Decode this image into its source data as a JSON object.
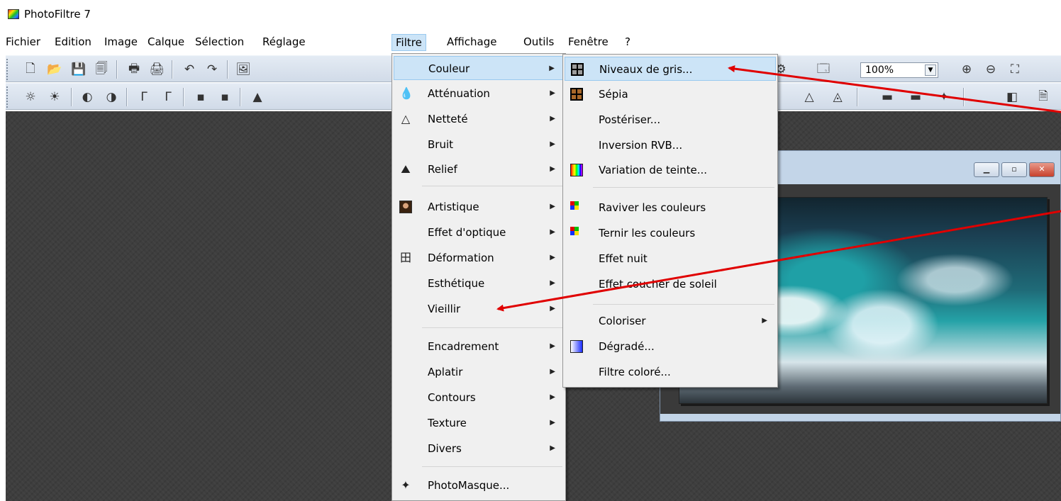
{
  "app": {
    "title": "PhotoFiltre 7"
  },
  "menubar": {
    "items": [
      "Fichier",
      "Edition",
      "Image",
      "Calque",
      "Sélection",
      "Réglage",
      "Filtre",
      "Affichage",
      "Outils",
      "Fenêtre",
      "?"
    ],
    "active": "Filtre"
  },
  "toolbar": {
    "zoom_value": "100%"
  },
  "filtre_menu": {
    "items": [
      {
        "label": "Couleur",
        "submenu": true,
        "highlighted": true,
        "icon": "none"
      },
      {
        "label": "Atténuation",
        "submenu": true,
        "icon": "drop-icon"
      },
      {
        "label": "Netteté",
        "submenu": true,
        "icon": "triangle-icon"
      },
      {
        "label": "Bruit",
        "submenu": true,
        "icon": "none"
      },
      {
        "label": "Relief",
        "submenu": true,
        "icon": "relief-icon"
      },
      {
        "label": "Artistique",
        "submenu": true,
        "icon": "portrait-icon"
      },
      {
        "label": "Effet d'optique",
        "submenu": true,
        "icon": "none"
      },
      {
        "label": "Déformation",
        "submenu": true,
        "icon": "grid-warp-icon"
      },
      {
        "label": "Esthétique",
        "submenu": true,
        "icon": "none"
      },
      {
        "label": "Vieillir",
        "submenu": true,
        "icon": "none"
      },
      {
        "label": "Encadrement",
        "submenu": true,
        "icon": "none"
      },
      {
        "label": "Aplatir",
        "submenu": true,
        "icon": "none"
      },
      {
        "label": "Contours",
        "submenu": true,
        "icon": "none"
      },
      {
        "label": "Texture",
        "submenu": true,
        "icon": "none"
      },
      {
        "label": "Divers",
        "submenu": true,
        "icon": "none"
      },
      {
        "label": "PhotoMasque...",
        "submenu": false,
        "icon": "photomasque-icon"
      }
    ]
  },
  "couleur_menu": {
    "items": [
      {
        "label": "Niveaux de gris...",
        "icon": "grayscale-icon",
        "highlighted": true
      },
      {
        "label": "Sépia",
        "icon": "sepia-icon"
      },
      {
        "label": "Postériser...",
        "icon": "none"
      },
      {
        "label": "Inversion RVB...",
        "icon": "none"
      },
      {
        "label": "Variation de teinte...",
        "icon": "hue-variation-icon"
      },
      {
        "label": "Raviver les couleurs",
        "icon": "color-plus-icon"
      },
      {
        "label": "Ternir les couleurs",
        "icon": "color-minus-icon"
      },
      {
        "label": "Effet nuit",
        "icon": "none"
      },
      {
        "label": "Effet coucher de soleil",
        "icon": "none"
      },
      {
        "label": "Coloriser",
        "icon": "none",
        "submenu": true
      },
      {
        "label": "Dégradé...",
        "icon": "gradient-icon"
      },
      {
        "label": "Filtre coloré...",
        "icon": "none"
      }
    ]
  },
  "colors": {
    "menu_highlight": "#cce4f7",
    "annotation_arrow": "#e00000",
    "toolbar_bg": "#d9e2ee",
    "workspace_bg": "#3e3e3e"
  }
}
